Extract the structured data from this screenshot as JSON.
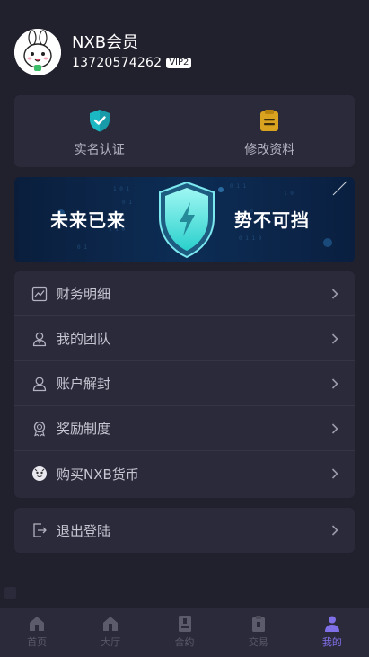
{
  "profile": {
    "name": "NXB会员",
    "phone": "13720574262",
    "vip": "VIP2"
  },
  "quick_actions": [
    {
      "label": "实名认证",
      "icon": "shield-check-icon",
      "color": "#1bb8c4"
    },
    {
      "label": "修改资料",
      "icon": "clipboard-icon",
      "color": "#d9a21f"
    }
  ],
  "banner": {
    "left_text": "未来已来",
    "right_text": "势不可挡",
    "accent": "#38e6e0"
  },
  "menu": [
    {
      "label": "财务明细",
      "icon": "chart-icon"
    },
    {
      "label": "我的团队",
      "icon": "team-icon"
    },
    {
      "label": "账户解封",
      "icon": "user-icon"
    },
    {
      "label": "奖励制度",
      "icon": "award-icon"
    },
    {
      "label": "购买NXB货币",
      "icon": "coin-icon"
    }
  ],
  "logout": {
    "label": "退出登陆",
    "icon": "logout-icon"
  },
  "tabbar": [
    {
      "label": "首页",
      "icon": "home-icon",
      "active": false
    },
    {
      "label": "大厅",
      "icon": "hall-icon",
      "active": false
    },
    {
      "label": "合约",
      "icon": "contract-icon",
      "active": false
    },
    {
      "label": "交易",
      "icon": "trade-icon",
      "active": false
    },
    {
      "label": "我的",
      "icon": "person-icon",
      "active": true
    }
  ],
  "colors": {
    "background": "#21202d",
    "card": "#2b2a3a",
    "active_tab": "#7f70e8"
  }
}
